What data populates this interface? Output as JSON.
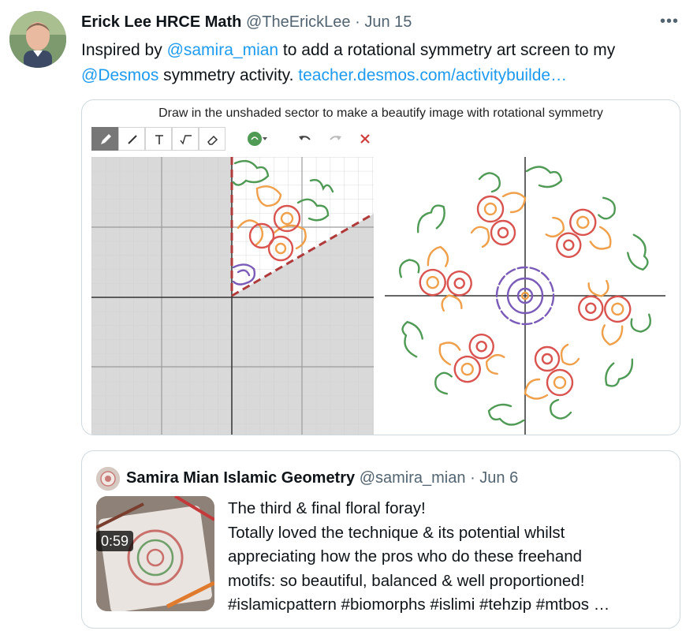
{
  "tweet": {
    "author_name": "Erick Lee HRCE Math",
    "handle": "@TheErickLee",
    "separator": "·",
    "date": "Jun 15",
    "more_label": "•••",
    "text_before": "Inspired by ",
    "mention1": "@samira_mian",
    "text_middle": " to add a rotational symmetry art screen to my ",
    "mention2": "@Desmos",
    "text_after": " symmetry activity. ",
    "link": "teacher.desmos.com/activitybuilde…"
  },
  "media": {
    "title": "Draw in the unshaded sector to make a beautify image with rotational symmetry",
    "tools": [
      "pencil-icon",
      "line-icon",
      "text-icon",
      "sqrt-icon",
      "eraser-icon",
      "color-icon",
      "undo-icon",
      "redo-icon",
      "clear-icon"
    ],
    "colors": {
      "grid_shaded": "#d9d9d9",
      "dash": "#b03a3a",
      "pink": "#d9534f",
      "orange": "#f0a04b",
      "green": "#4f9a55",
      "purple": "#7a5bb8"
    }
  },
  "quote": {
    "author_name": "Samira Mian Islamic Geometry",
    "handle": "@samira_mian",
    "separator": "·",
    "date": "Jun 6",
    "video_duration": "0:59",
    "lines": [
      "The third & final floral foray!",
      "Totally loved the technique & its potential whilst",
      "appreciating how the pros who do these freehand",
      "motifs: so beautiful, balanced & well proportioned!",
      "#islamicpattern #biomorphs #islimi #tehzip #mtbos …"
    ]
  }
}
